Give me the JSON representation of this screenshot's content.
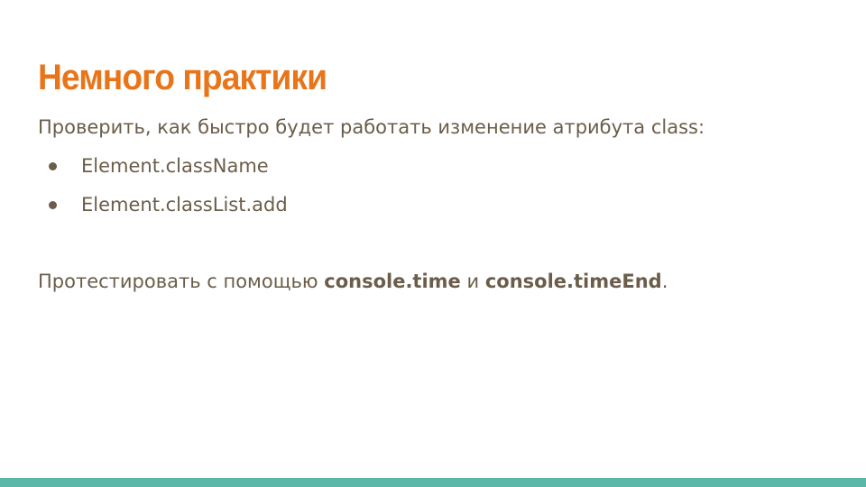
{
  "colors": {
    "title": "#e8751a",
    "text": "#6b5d4a",
    "bullet": "#6b5d4a",
    "bottom_bar": "#5bb8a8",
    "background": "#ffffff"
  },
  "slide": {
    "title": "Немного практики",
    "intro": "Проверить, как быстро будет работать изменение атрибута class:",
    "bullets": [
      "Element.className",
      "Element.classList.add"
    ],
    "test_line": {
      "prefix": "Протестировать с помощью ",
      "code1": "console.time",
      "middle": " и ",
      "code2": "console.timeEnd",
      "suffix": "."
    }
  }
}
